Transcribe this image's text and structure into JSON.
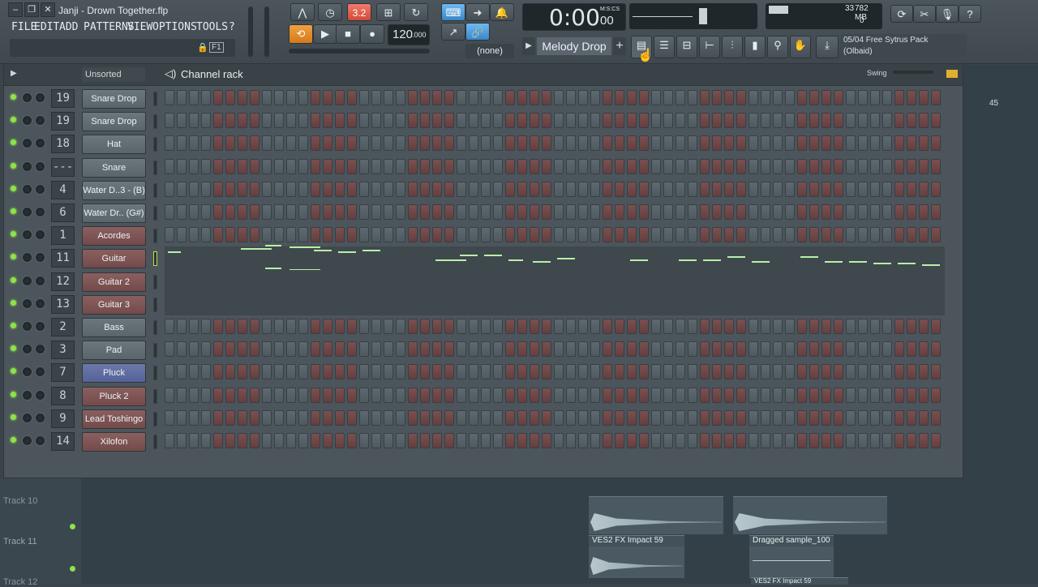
{
  "window": {
    "title": "Janji - Drown Together.flp"
  },
  "menu": [
    "FILE",
    "EDIT",
    "ADD",
    "PATTERNS",
    "VIEW",
    "OPTIONS",
    "TOOLS",
    "?"
  ],
  "transport": {
    "tempo_main": "120",
    "tempo_frac": ".000",
    "time": "0:00",
    "time_sub": "00",
    "time_unit": "M:S:CS",
    "pattern_none": "(none)",
    "pattern_name": "Melody Drop",
    "pattern_mode": "3.2"
  },
  "monitor": {
    "cpu": "33",
    "memory": "782 MB",
    "poly": "0"
  },
  "hint": {
    "line1": "05/04  Free Sytrus Pack",
    "line2": "(Olbaid)"
  },
  "rack": {
    "filter": "Unsorted",
    "title": "Channel rack",
    "swing_label": "Swing",
    "add_label": "+",
    "channels": [
      {
        "num": "19",
        "name": "Snare Drop",
        "color": "grey"
      },
      {
        "num": "19",
        "name": "Snare Drop",
        "color": "grey"
      },
      {
        "num": "18",
        "name": "Hat",
        "color": "grey"
      },
      {
        "num": "---",
        "name": "Snare",
        "color": "grey"
      },
      {
        "num": "4",
        "name": "Water D..3 - (B)",
        "color": "grey"
      },
      {
        "num": "6",
        "name": "Water Dr.. (G#)",
        "color": "grey"
      },
      {
        "num": "1",
        "name": "Acordes",
        "color": "red"
      },
      {
        "num": "11",
        "name": "Guitar",
        "color": "red"
      },
      {
        "num": "12",
        "name": "Guitar 2",
        "color": "red"
      },
      {
        "num": "13",
        "name": "Guitar 3",
        "color": "red"
      },
      {
        "num": "2",
        "name": "Bass",
        "color": "grey"
      },
      {
        "num": "3",
        "name": "Pad",
        "color": "grey"
      },
      {
        "num": "7",
        "name": "Pluck",
        "color": "blue"
      },
      {
        "num": "8",
        "name": "Pluck 2",
        "color": "red"
      },
      {
        "num": "9",
        "name": "Lead Toshingo",
        "color": "red"
      },
      {
        "num": "14",
        "name": "Xilofon",
        "color": "red"
      }
    ]
  },
  "playlist": {
    "bar_number": "45",
    "tracks": [
      "Track 10",
      "Track 11",
      "Track 12"
    ],
    "clips": [
      "VES2 FX Impact 59",
      "Dragged sample_100",
      "VES2 FX Impact 59"
    ]
  },
  "colors": {
    "accent_orange": "#e88a2a",
    "accent_blue": "#4ea0e0",
    "led": "#8ee24a"
  }
}
